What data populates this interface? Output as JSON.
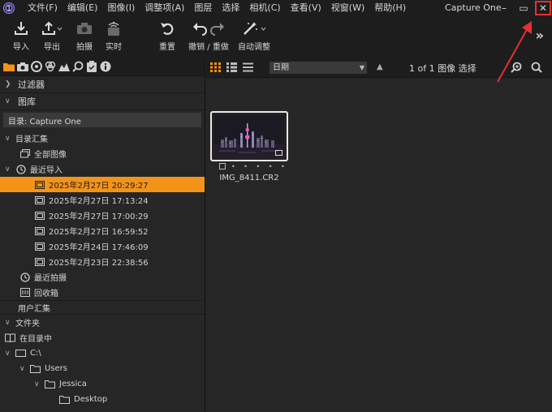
{
  "menubar": {
    "items": [
      "文件(F)",
      "编辑(E)",
      "图像(I)",
      "调整项(A)",
      "图层",
      "选择",
      "相机(C)",
      "查看(V)",
      "视窗(W)",
      "帮助(H)"
    ],
    "window_title": "Capture One",
    "minimize_glyph": "–",
    "maximize_glyph": "▭",
    "close_glyph": "✕"
  },
  "toolbar": {
    "import_label": "导入",
    "export_label": "导出",
    "capture_label": "拍摄",
    "live_label": "实时",
    "reset_label": "重置",
    "undo_redo_label": "撤销 / 重做",
    "auto_adjust_label": "自动调整",
    "more_glyph": "»"
  },
  "sidebar": {
    "filters_label": "过滤器",
    "library_label": "图库",
    "catalog_label": "目录: Capture One",
    "catalog_collections_label": "目录汇集",
    "all_images_label": "全部图像",
    "recent_imports_label": "最近导入",
    "imports": [
      "2025年2月27日 20:29:27",
      "2025年2月27日 17:13:24",
      "2025年2月27日 17:00:29",
      "2025年2月27日 16:59:52",
      "2025年2月24日 17:46:09",
      "2025年2月23日 22:38:56"
    ],
    "recent_captures_label": "最近拍摄",
    "trash_label": "回收箱",
    "user_collections_label": "用户汇集",
    "folders_label": "文件夹",
    "in_catalog_label": "在目录中",
    "drive_label": "C:\\",
    "users_label": "Users",
    "jessica_label": "Jessica",
    "desktop_label": "Desktop"
  },
  "browser": {
    "sort_value": "日期",
    "count_text": "1 of 1 图像 选择",
    "thumbnail_filename": "IMG_8411.CR2",
    "rating_dots": "• • • • •"
  },
  "colors": {
    "accent_selected": "#f39419",
    "annotation_red": "#e53030"
  }
}
